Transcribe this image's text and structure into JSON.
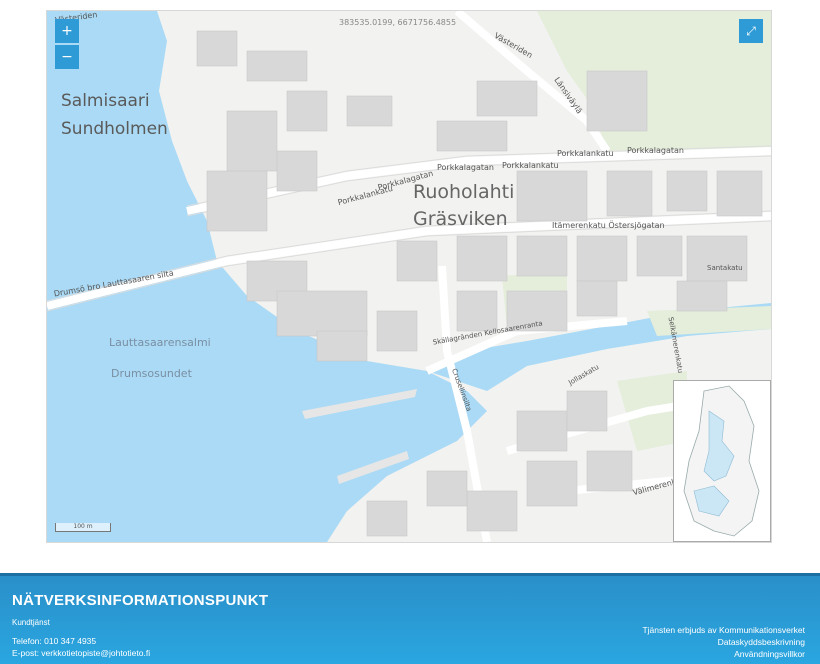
{
  "map": {
    "zoom_in_label": "+",
    "zoom_out_label": "−",
    "fullscreen_icon": "expand-icon",
    "coordinates": "383535.0199, 6671756.4855",
    "scale_label": "100 m",
    "places": {
      "salmisaari": "Salmisaari",
      "sundholmen": "Sundholmen",
      "ruoholahti": "Ruoholahti",
      "grasviken": "Gräsviken",
      "lauttasaarensalmi": "Lauttasaarensalmi",
      "drumsosundet": "Drumsosundet"
    },
    "streets": {
      "porkkalankatu": "Porkkalankatu",
      "porkkalagatan": "Porkkalagatan",
      "porkkalankatu2": "Porkkalankatu",
      "porkkalagatan2": "Porkkalagatan",
      "porkkalankatu3": "Porkkalankatu",
      "porkkalagatan3": "Porkkalagatan",
      "lauttasaaren_silta": "Drumsö bro   Lauttasaaren silta",
      "itamerenkatu": "Itämerenkatu   Östersjögatan",
      "lansivayla": "Länsiväylä",
      "vasteriden": "Västeriden",
      "vasteriden2": "Västeriden",
      "santakatu": "Santakatu",
      "selkamerenkatu": "Selkämerenkatu",
      "kellosaarenranta": "Skällagränden   Kellosaarenranta",
      "crusellinsilta": "Crusellinsilta",
      "jollaskatu": "Jollaskatu",
      "vaimerenkatu": "Välimerenkatu"
    },
    "colors": {
      "water": "#aadaf5",
      "land": "#f2f2f0",
      "park": "#e4eedb",
      "building": "#d8d8d8",
      "road": "#ffffff"
    }
  },
  "footer": {
    "title": "NÄTVERKSINFORMATIONSPUNKT",
    "subtitle": "Kundtjänst",
    "phone": "Telefon: 010 347 4935",
    "email": "E-post: verkkotietopiste@johtotieto.fi",
    "links": [
      "Tjänsten erbjuds av Kommunikationsverket",
      "Dataskyddsbeskrivning",
      "Användningsvillkor"
    ]
  }
}
